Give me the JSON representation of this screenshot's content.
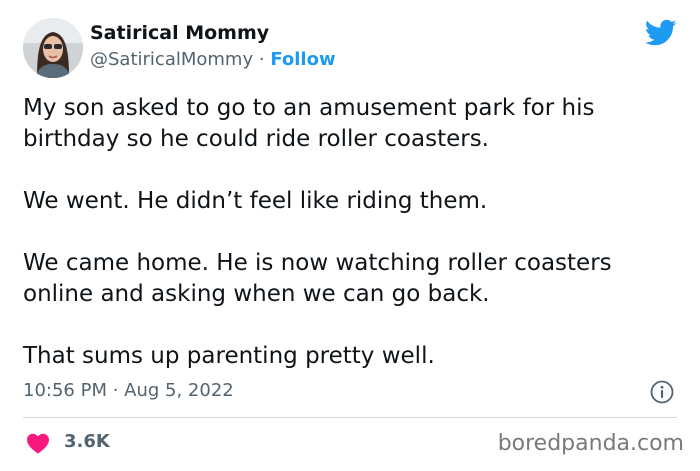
{
  "author": {
    "display_name": "Satirical Mommy",
    "handle": "@SatiricalMommy",
    "separator": "·",
    "follow_label": "Follow"
  },
  "tweet": {
    "paragraphs": [
      "My son asked to go to an amusement park for his birthday so he could ride roller coasters.",
      "We went. He didn’t feel like riding them.",
      "We came home. He is now watching roller coasters online and asking when we can go back.",
      "That sums up parenting pretty well."
    ],
    "timestamp": "10:56 PM · Aug 5, 2022"
  },
  "stats": {
    "likes": "3.6K"
  },
  "watermark": "boredpanda.com",
  "icons": {
    "brand": "twitter-bird-icon",
    "info": "info-icon",
    "like": "heart-icon"
  },
  "colors": {
    "twitter_blue": "#1d9bf0",
    "heart_red": "#f91880",
    "text_primary": "#0f1419",
    "text_secondary": "#536471",
    "divider": "#cfd9de"
  }
}
